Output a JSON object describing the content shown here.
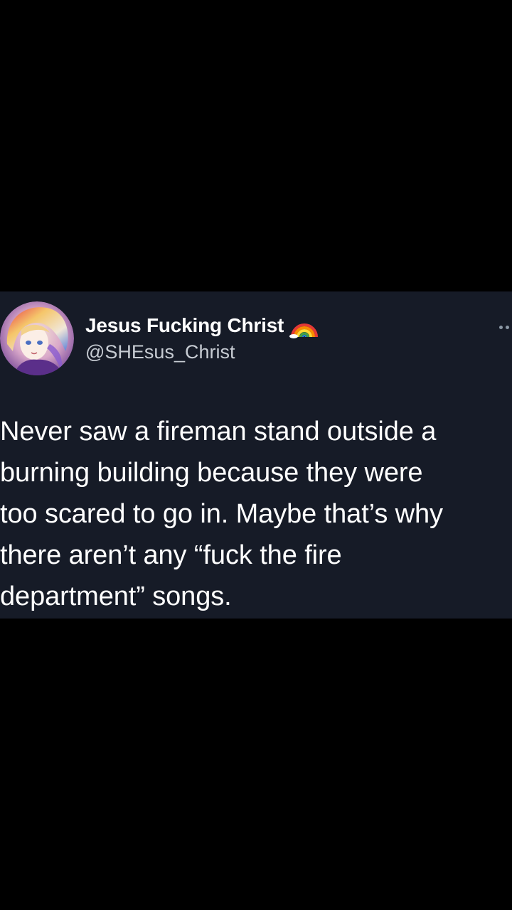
{
  "tweet": {
    "display_name": "Jesus Fucking Christ",
    "handle": "@SHEsus_Christ",
    "badge_icon": "rainbow-icon",
    "text": "Never saw a fireman stand outside a\nburning building because they were\ntoo scared to go in. Maybe that’s why\nthere aren’t any “fuck the fire\ndepartment” songs."
  },
  "colors": {
    "page_background": "#000000",
    "card_background": "#161b27",
    "primary_text": "#ffffff",
    "secondary_text": "#c7ccd3"
  }
}
